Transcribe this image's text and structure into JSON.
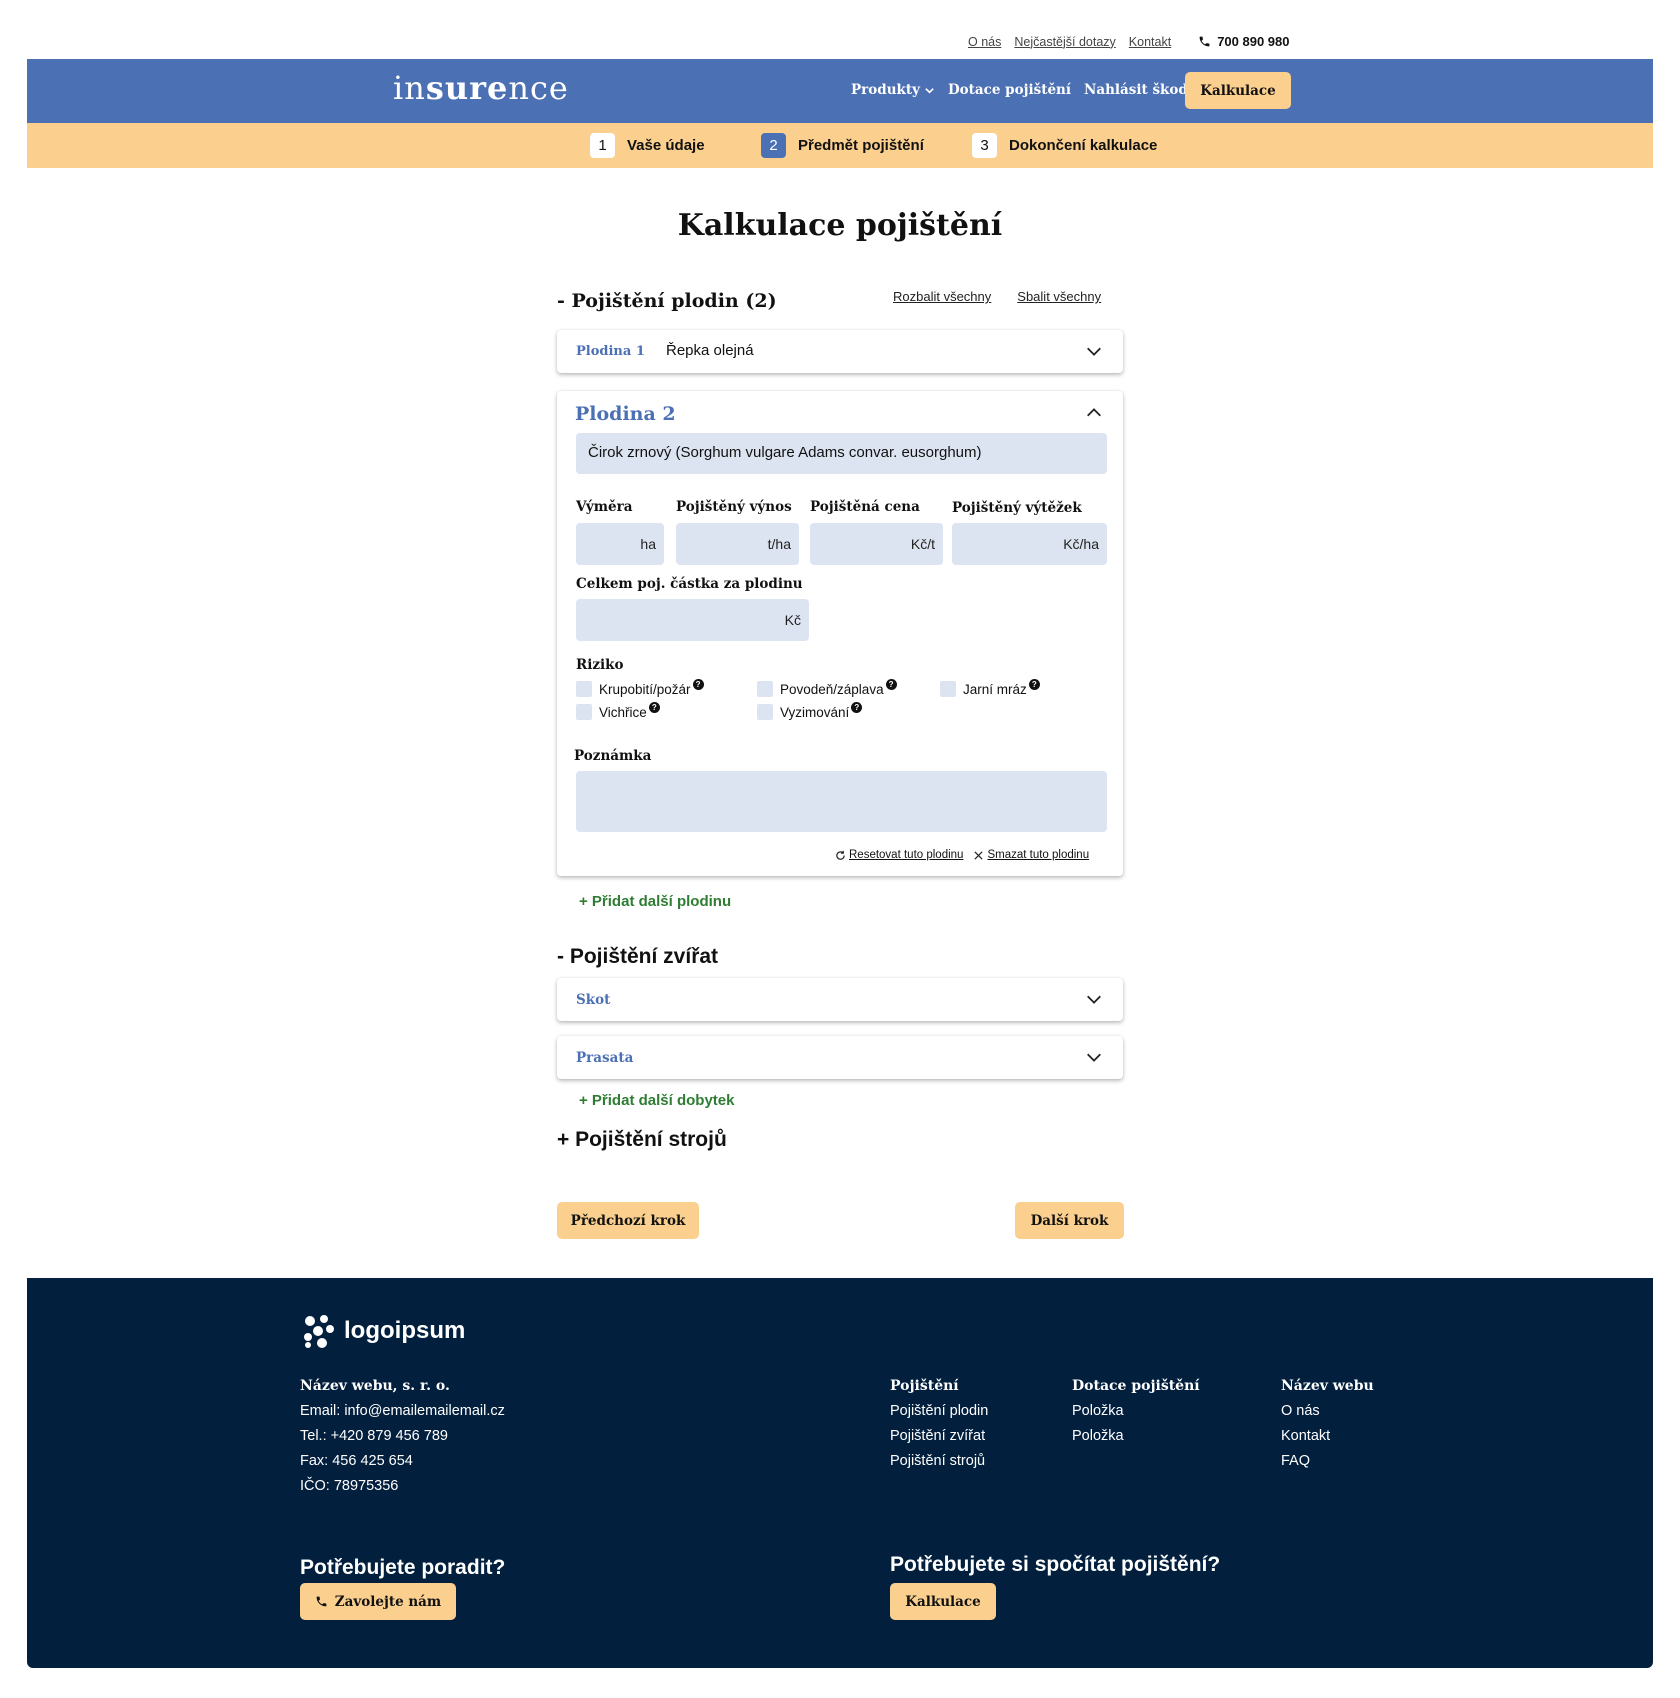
{
  "util": {
    "links": [
      "O nás",
      "Nejčastější dotazy",
      "Kontakt"
    ],
    "phone": "700 890 980"
  },
  "header": {
    "logo_pre": "in",
    "logo_bold": "sure",
    "logo_post": "nce",
    "nav": [
      "Produkty",
      "Dotace pojištění",
      "Nahlásit škodu"
    ],
    "cta": "Kalkulace"
  },
  "steps": [
    {
      "num": "1",
      "label": "Vaše údaje"
    },
    {
      "num": "2",
      "label": "Předmět pojištění"
    },
    {
      "num": "3",
      "label": "Dokončení kalkulace"
    }
  ],
  "title": "Kalkulace pojištění",
  "crops": {
    "section_title": "- Pojištění plodin (2)",
    "expand_all": "Rozbalit všechny",
    "collapse_all": "Sbalit všechny",
    "crop1": {
      "label": "Plodina 1",
      "value": "Řepka olejná"
    },
    "crop2": {
      "label": "Plodina 2",
      "select_value": "Čirok zrnový (Sorghum vulgare Adams convar. eusorghum)",
      "fields": [
        {
          "label": "Výměra",
          "unit": "ha"
        },
        {
          "label": "Pojištěný výnos",
          "unit": "t/ha"
        },
        {
          "label": "Pojištěná cena",
          "unit": "Kč/t"
        },
        {
          "label": "Pojištěný výtěžek",
          "unit": "Kč/ha"
        }
      ],
      "total": {
        "label": "Celkem poj. částka za plodinu",
        "unit": "Kč"
      },
      "risk_label": "Riziko",
      "risks": [
        "Krupobití/požár",
        "Povodeň/záplava",
        "Jarní mráz",
        "Vichřice",
        "Vyzimování"
      ],
      "note_label": "Poznámka",
      "reset": "Resetovat tuto plodinu",
      "delete": "Smazat tuto plodinu"
    },
    "add": "+ Přidat další plodinu"
  },
  "animals": {
    "section_title": "- Pojištění zvířat",
    "items": [
      "Skot",
      "Prasata"
    ],
    "add": "+ Přidat další dobytek"
  },
  "machines": {
    "section_title": "+ Pojištění strojů"
  },
  "buttons": {
    "prev": "Předchozí krok",
    "next": "Další krok"
  },
  "footer": {
    "logo": "logoipsum",
    "company": {
      "title": "Název webu, s. r. o.",
      "lines": [
        "Email: info@emailemailemail.cz",
        "Tel.: +420 879 456 789",
        "Fax: 456 425 654",
        "IČO: 78975356"
      ]
    },
    "cols": [
      {
        "title": "Pojištění",
        "items": [
          "Pojištění plodin",
          "Pojištění zvířat",
          "Pojištění strojů"
        ]
      },
      {
        "title": "Dotace pojištění",
        "items": [
          "Položka",
          "Položka"
        ]
      },
      {
        "title": "Název webu",
        "items": [
          "O nás",
          "Kontakt",
          "FAQ"
        ]
      }
    ],
    "advice": {
      "heading": "Potřebujete poradit?",
      "button": "Zavolejte nám"
    },
    "calc": {
      "heading": "Potřebujete si spočítat pojištění?",
      "button": "Kalkulace"
    }
  }
}
